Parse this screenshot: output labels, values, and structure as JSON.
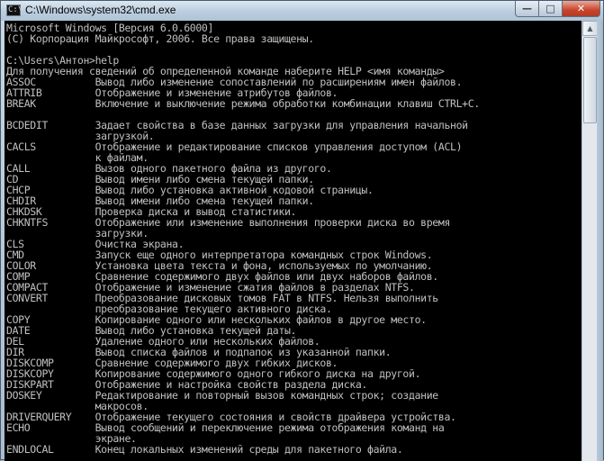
{
  "window": {
    "title": "C:\\Windows\\system32\\cmd.exe",
    "icon_label": "C:\\",
    "controls": {
      "minimize_glyph": "—",
      "maximize_glyph": "□",
      "close_glyph": "✕"
    }
  },
  "scrollbar": {
    "up_arrow_glyph": "▲"
  },
  "console": {
    "lines": [
      "Microsoft Windows [Версия 6.0.6000]",
      "(C) Корпорация Майкрософт, 2006. Все права защищены.",
      "",
      "C:\\Users\\Антон>help",
      "Для получения сведений об определенной команде наберите HELP <имя команды>",
      "ASSOC          Вывод либо изменение сопоставлений по расширениям имен файлов.",
      "ATTRIB         Отображение и изменение атрибутов файлов.",
      "BREAK          Включение и выключение режима обработки комбинации клавиш CTRL+C.",
      "",
      "BCDEDIT        Задает свойства в базе данных загрузки для управления начальной",
      "               загрузкой.",
      "CACLS          Отображение и редактирование списков управления доступом (ACL)",
      "               к файлам.",
      "CALL           Вызов одного пакетного файла из другого.",
      "CD             Вывод имени либо смена текущей папки.",
      "CHCP           Вывод либо установка активной кодовой страницы.",
      "CHDIR          Вывод имени либо смена текущей папки.",
      "CHKDSK         Проверка диска и вывод статистики.",
      "CHKNTFS        Отображение или изменение выполнения проверки диска во время",
      "               загрузки.",
      "CLS            Очистка экрана.",
      "CMD            Запуск еще одного интерпретатора командных строк Windows.",
      "COLOR          Установка цвета текста и фона, используемых по умолчанию.",
      "COMP           Сравнение содержимого двух файлов или двух наборов файлов.",
      "COMPACT        Отображение и изменение сжатия файлов в разделах NTFS.",
      "CONVERT        Преобразование дисковых томов FAT в NTFS. Нельзя выполнить",
      "               преобразование текущего активного диска.",
      "COPY           Копирование одного или нескольких файлов в другое место.",
      "DATE           Вывод либо установка текущей даты.",
      "DEL            Удаление одного или нескольких файлов.",
      "DIR            Вывод списка файлов и подпапок из указанной папки.",
      "DISKCOMP       Сравнение содержимого двух гибких дисков.",
      "DISKCOPY       Копирование содержимого одного гибкого диска на другой.",
      "DISKPART       Отображение и настройка свойств раздела диска.",
      "DOSKEY         Редактирование и повторный вызов командных строк; создание",
      "               макросов.",
      "DRIVERQUERY    Отображение текущего состояния и свойств драйвера устройства.",
      "ECHO           Вывод сообщений и переключение режима отображения команд на",
      "               экране.",
      "ENDLOCAL       Конец локальных изменений среды для пакетного файла."
    ]
  }
}
